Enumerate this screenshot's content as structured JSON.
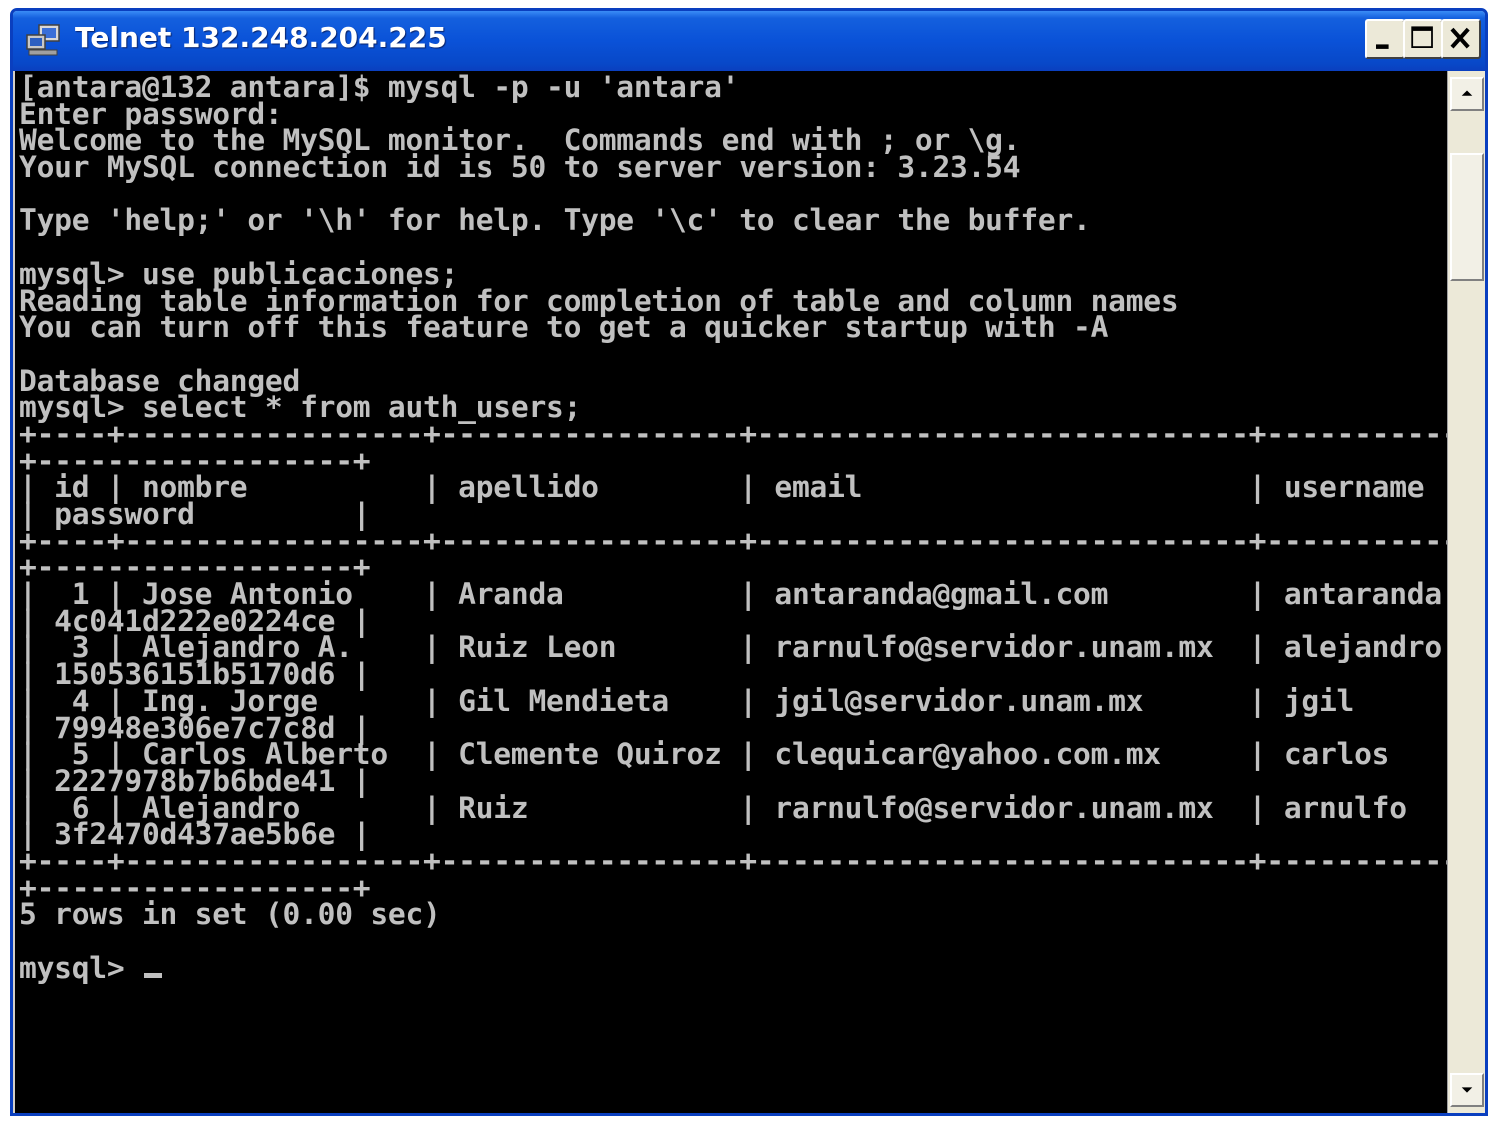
{
  "window": {
    "title": "Telnet 132.248.204.225",
    "icon": "telnet-icon"
  },
  "title_buttons": [
    "minimize-icon",
    "maximize-icon",
    "close-icon"
  ],
  "terminal": {
    "lines": [
      "[antara@132 antara]$ mysql -p -u 'antara'",
      "Enter password:",
      "Welcome to the MySQL monitor.  Commands end with ; or \\g.",
      "Your MySQL connection id is 50 to server version: 3.23.54",
      "",
      "Type 'help;' or '\\h' for help. Type '\\c' to clear the buffer.",
      "",
      "mysql> use publicaciones;",
      "Reading table information for completion of table and column names",
      "You can turn off this feature to get a quicker startup with -A",
      "",
      "Database changed",
      "mysql> select * from auth_users;",
      "+----+-----------------+-----------------+----------------------------+-------------",
      "+------------------+",
      "| id | nombre          | apellido        | email                      | username",
      "| password         |",
      "+----+-----------------+-----------------+----------------------------+-------------",
      "+------------------+",
      "|  1 | Jose Antonio    | Aranda          | antaranda@gmail.com        | antaranda",
      "| 4c041d222e0224ce |",
      "|  3 | Alejandro A.    | Ruiz Leon       | rarnulfo@servidor.unam.mx  | alejandro",
      "| 150536151b5170d6 |",
      "|  4 | Ing. Jorge      | Gil Mendieta    | jgil@servidor.unam.mx      | jgil",
      "| 79948e306e7c7c8d |",
      "|  5 | Carlos Alberto  | Clemente Quiroz | clequicar@yahoo.com.mx     | carlos",
      "| 2227978b7b6bde41 |",
      "|  6 | Alejandro       | Ruiz            | rarnulfo@servidor.unam.mx  | arnulfo",
      "| 3f2470d437ae5b6e |",
      "+----+-----------------+-----------------+----------------------------+-------------",
      "+------------------+",
      "5 rows in set (0.00 sec)",
      "",
      "mysql> "
    ]
  },
  "scrollbar": {
    "up_icon": "arrow-up-icon",
    "down_icon": "arrow-down-icon"
  },
  "colors": {
    "title_bar": "#0a52d8",
    "console_bg": "#000000",
    "console_fg": "#c0c0c0"
  }
}
